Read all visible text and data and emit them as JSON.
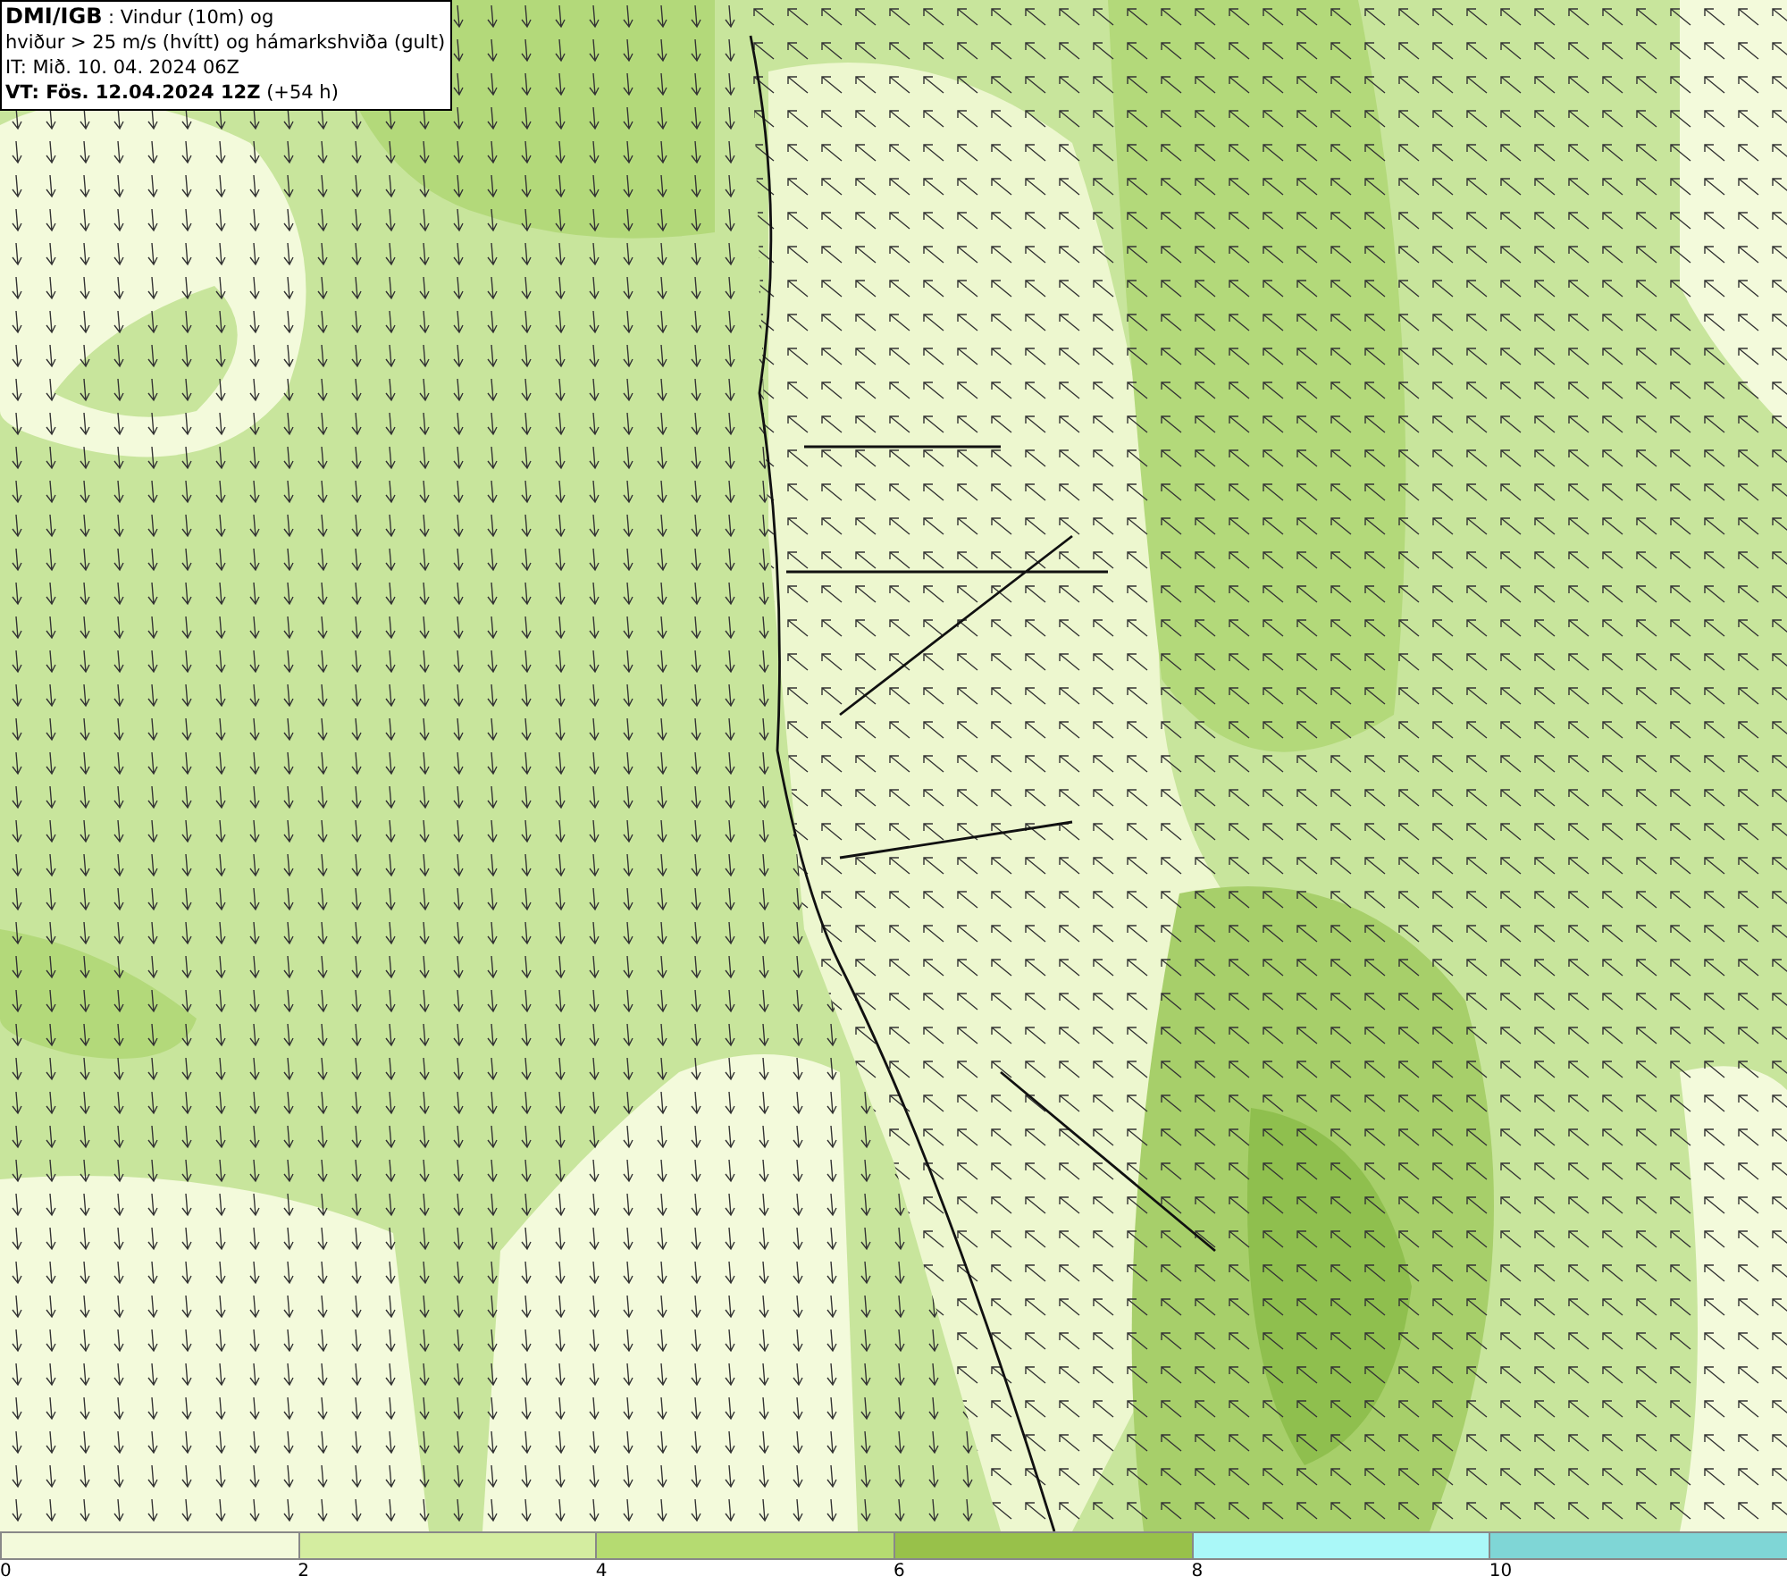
{
  "info_box": {
    "source": "DMI/IGB",
    "description": " : Vindur (10m) og",
    "line_2": "hviður > 25 m/s (hvítt) og hámarkshviða (gult)",
    "issue_time": "IT: Mið. 10. 04. 2024 06Z",
    "valid_time": "VT: Fös. 12.04.2024 12Z",
    "lead_time": " (+54 h)"
  },
  "legend": {
    "bins": [
      {
        "color": "#f3fadb"
      },
      {
        "color": "#d4eda0"
      },
      {
        "color": "#b5db71"
      },
      {
        "color": "#98c14a"
      },
      {
        "color": "#aaf8f8"
      },
      {
        "color": "#7fd6d6"
      }
    ],
    "ticks": [
      "0",
      "2",
      "4",
      "6",
      "8",
      "10"
    ]
  }
}
